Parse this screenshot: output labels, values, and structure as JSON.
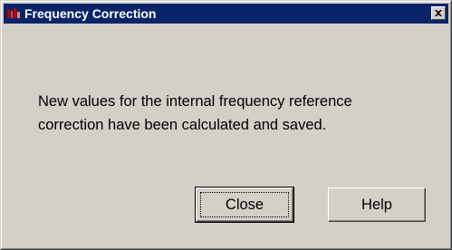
{
  "window": {
    "title": "Frequency Correction",
    "icon": "app-icon",
    "close_icon": "close-icon"
  },
  "message": {
    "line1": "New values for the internal frequency reference",
    "line2": "correction have been calculated and saved."
  },
  "buttons": {
    "close_label": "Close",
    "help_label": "Help"
  },
  "colors": {
    "titlebar": "#0a246a",
    "face": "#d4d0c8"
  }
}
